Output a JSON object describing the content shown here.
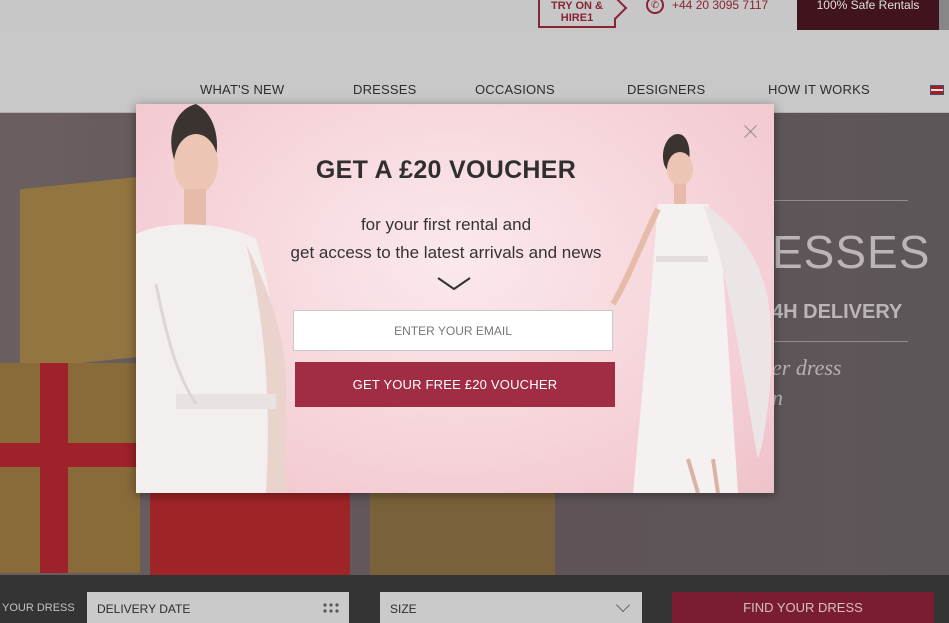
{
  "topbar": {
    "try_badge": [
      "TRY ON &",
      "HIRE1"
    ],
    "phone": "+44 20 3095 7117",
    "safe_rentals": "100% Safe Rentals"
  },
  "nav": {
    "items": [
      "WHAT'S NEW",
      "DRESSES",
      "OCCASIONS",
      "DESIGNERS",
      "HOW IT WORKS"
    ]
  },
  "hero": {
    "headline": "ESSES",
    "delivery": "4H DELIVERY",
    "script_lines": [
      "er dress",
      "n"
    ]
  },
  "search": {
    "label": "YOUR DRESS",
    "delivery_date": "DELIVERY DATE",
    "size": "SIZE",
    "find_button": "FIND YOUR DRESS"
  },
  "modal": {
    "title": "GET A £20 VOUCHER",
    "subtitle_line1": "for your first rental and",
    "subtitle_line2": "get access to the latest arrivals and news",
    "email_placeholder": "ENTER YOUR EMAIL",
    "cta_label": "GET YOUR FREE £20 VOUCHER"
  },
  "colors": {
    "brand": "#a02d44",
    "dark_brand": "#4a1620",
    "modal_bg": "#f4cfd5"
  }
}
